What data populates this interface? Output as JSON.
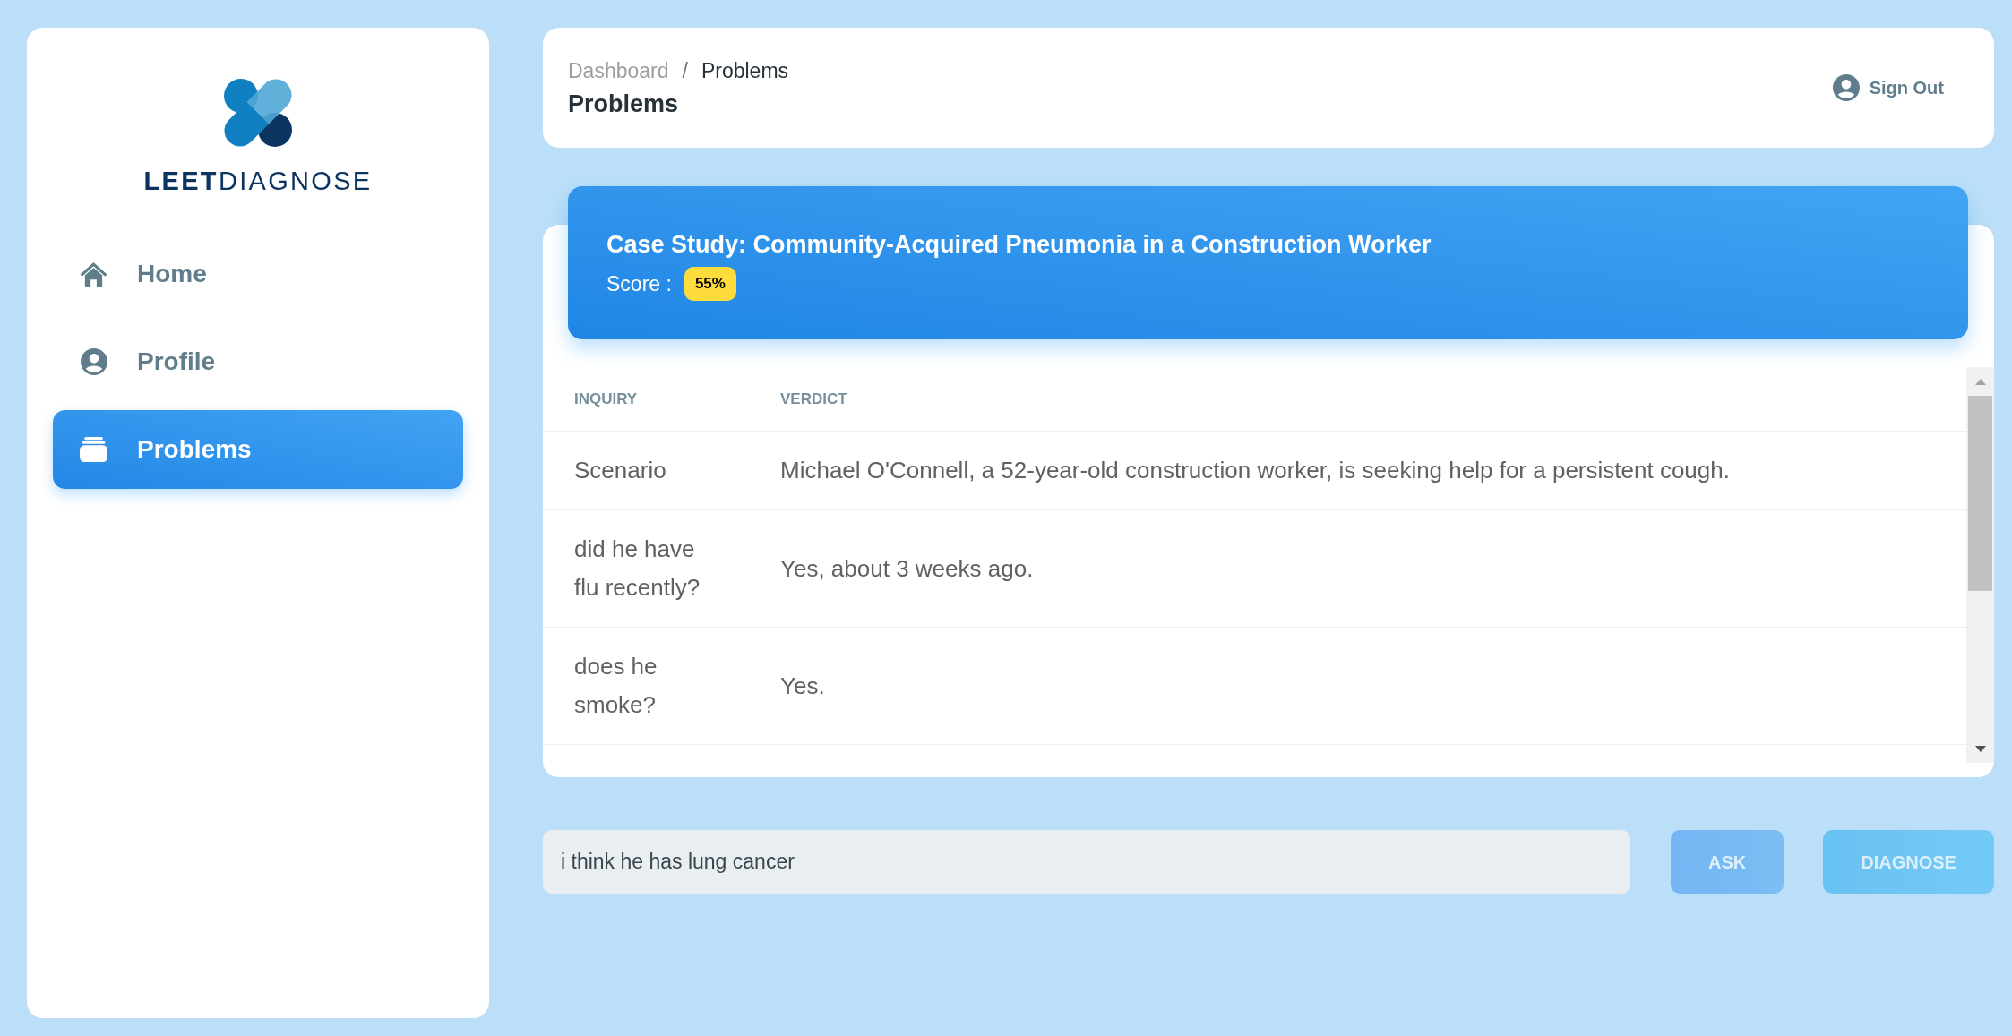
{
  "sidebar": {
    "logo_text": "**LEET**DIAGNOSE",
    "items": [
      {
        "label": "Home",
        "selected": false
      },
      {
        "label": "Profile",
        "selected": false
      },
      {
        "label": "Problems",
        "selected": true
      }
    ]
  },
  "header": {
    "breadcrumb": [
      {
        "label": "Dashboard",
        "current": false
      },
      {
        "label": "Problems",
        "current": true
      }
    ],
    "breadcrumb_separator": "/",
    "title": "Problems",
    "sign_out": "Sign Out"
  },
  "case_study": {
    "title": "Case Study: Community-Acquired Pneumonia in a Construction Worker",
    "score_label": "Score :",
    "score": "55%"
  },
  "table": {
    "columns": [
      "INQUIRY",
      "VERDICT"
    ],
    "rows": [
      {
        "inquiry": "Scenario",
        "verdict": "Michael O'Connell, a 52-year-old construction worker, is seeking help for a persistent cough."
      },
      {
        "inquiry": "did he have flu recently?",
        "verdict": "Yes, about 3 weeks ago."
      },
      {
        "inquiry": "does he smoke?",
        "verdict": "Yes."
      }
    ]
  },
  "question_input": {
    "value": "i think he has lung cancer"
  },
  "buttons": [
    {
      "label": "ASK",
      "kind": "primary",
      "disabled": true
    },
    {
      "label": "DIAGNOSE",
      "kind": "info",
      "disabled": true
    }
  ]
}
